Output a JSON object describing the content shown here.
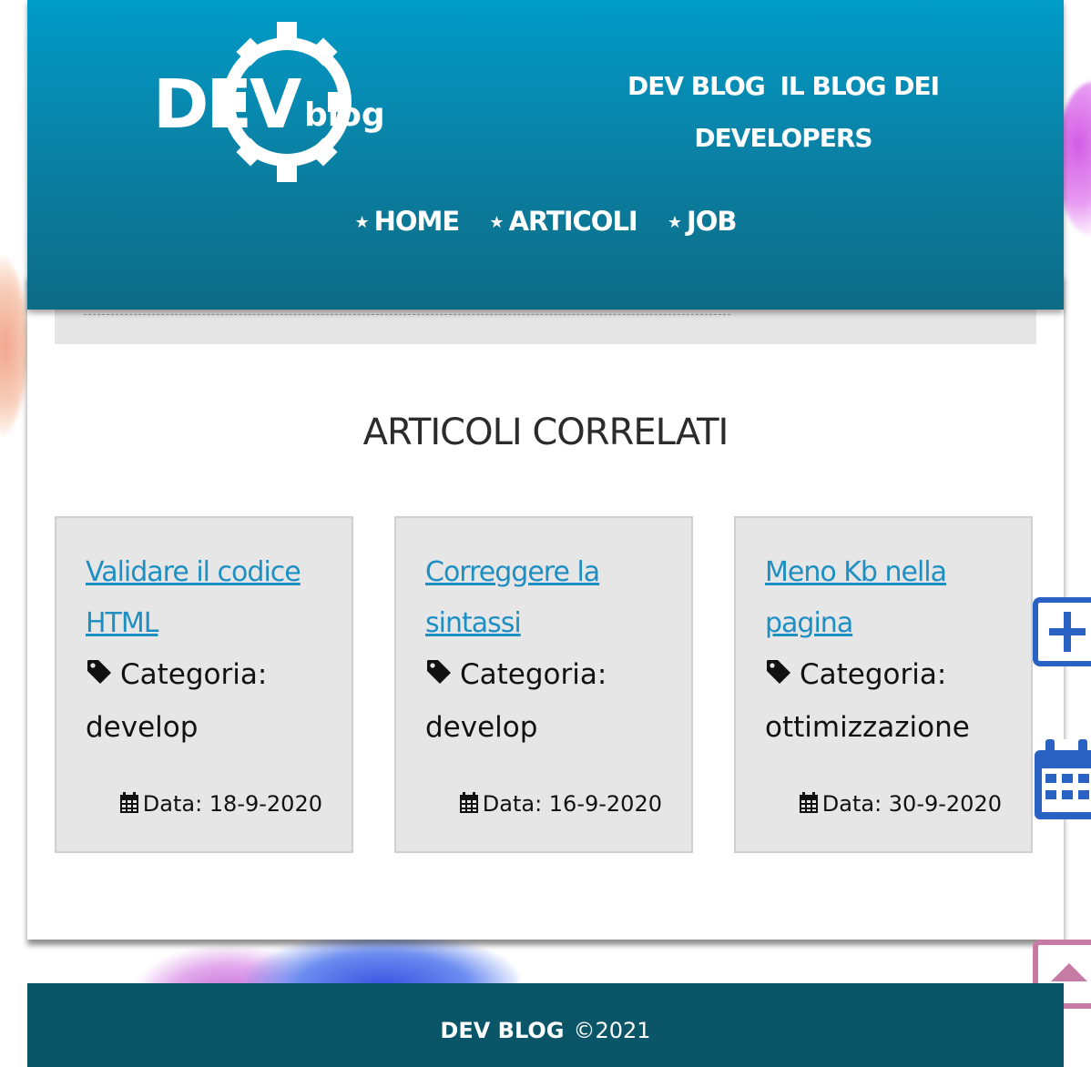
{
  "header": {
    "logo_text": "DEVblog",
    "site_title_part1": "DEV BLOG",
    "site_title_part2": "IL BLOG DEI",
    "site_title_part3": "DEVELOPERS",
    "nav": [
      {
        "label": "HOME",
        "icon": "star-icon"
      },
      {
        "label": "ARTICOLI",
        "icon": "star-icon"
      },
      {
        "label": "JOB",
        "icon": "star-icon"
      }
    ]
  },
  "related": {
    "title": "ARTICOLI CORRELATI",
    "articles": [
      {
        "title": "Validare il codice HTML",
        "category_label": "Categoria:",
        "category": "develop",
        "date": "Data: 18-9-2020"
      },
      {
        "title": "Correggere la sintassi",
        "category_label": "Categoria:",
        "category": "develop",
        "date": "Data: 16-9-2020"
      },
      {
        "title": "Meno Kb nella pagina",
        "category_label": "Categoria:",
        "category": "ottimizzazione",
        "date": "Data: 30-9-2020"
      }
    ]
  },
  "side_buttons": [
    {
      "icon": "plus-icon"
    },
    {
      "icon": "calendar-icon"
    },
    {
      "icon": "arrow-up-icon"
    }
  ],
  "footer": {
    "brand": "DEV BLOG",
    "copyright": "©2021"
  },
  "colors": {
    "header_top": "#009cc8",
    "header_bottom": "#0d6b85",
    "link": "#1d8fc2",
    "footer": "#0a5568",
    "card_bg": "#e6e6e6",
    "side_blue": "#2a62c4",
    "side_pink": "#c57ba4"
  }
}
